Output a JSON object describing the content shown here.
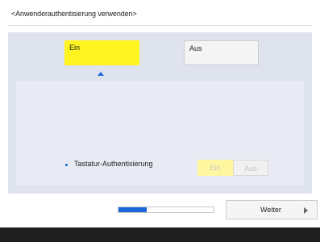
{
  "screen": {
    "title": "<Anwenderauthentisierung verwenden>"
  },
  "main_toggle": {
    "on_label": "Ein",
    "off_label": "Aus",
    "selected": "Ein"
  },
  "keyboard_auth": {
    "label": "Tastatur-Authentisierung",
    "on_label": "Ein",
    "off_label": "Aus",
    "selected": "Ein",
    "enabled": false
  },
  "footer": {
    "progress_fraction": 0.3,
    "next_label": "Weiter"
  },
  "colors": {
    "accent": "#1a67d8",
    "selected": "#fff41f",
    "panel": "#dfe3ee"
  },
  "icons": {
    "pointer": "triangle-up-icon",
    "next": "triangle-right-icon",
    "bullet": "bullet-icon"
  }
}
